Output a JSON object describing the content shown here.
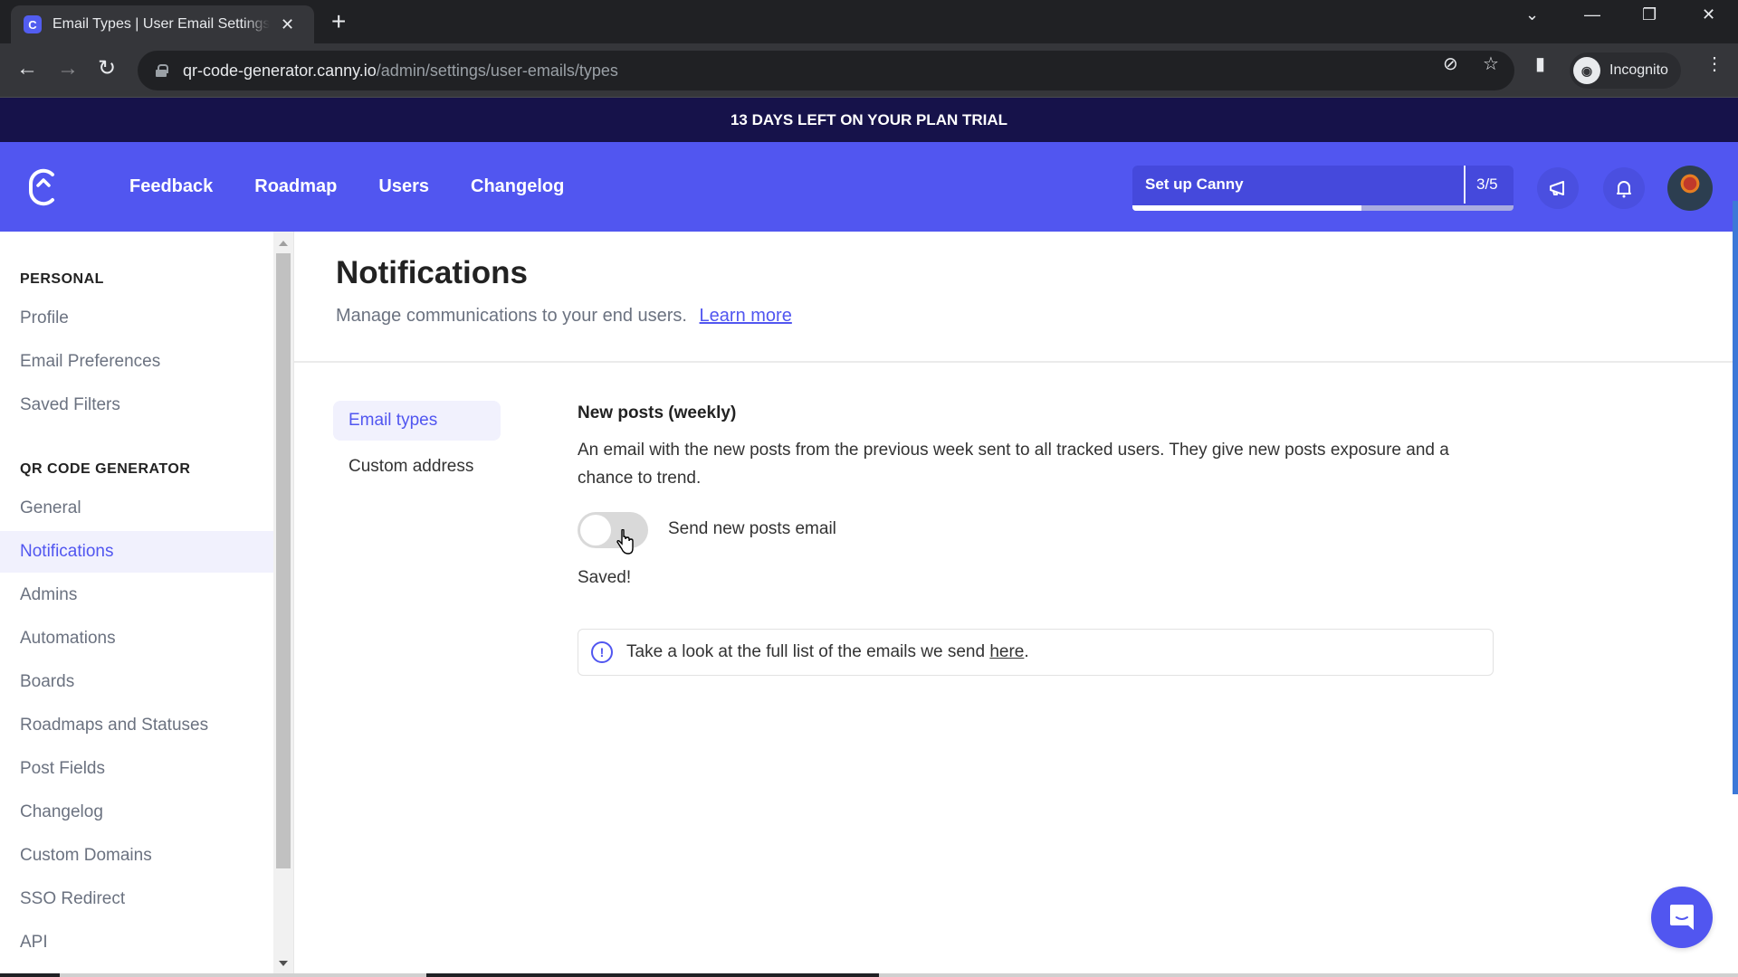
{
  "browser": {
    "tab_title": "Email Types | User Email Settings",
    "tab_favicon": "canny-icon",
    "url_host": "qr-code-generator.canny.io",
    "url_path": "/admin/settings/user-emails/types",
    "profile_label": "Incognito"
  },
  "banner": {
    "text": "13 DAYS LEFT ON YOUR PLAN TRIAL"
  },
  "header": {
    "nav": [
      "Feedback",
      "Roadmap",
      "Users",
      "Changelog"
    ],
    "setup": {
      "label": "Set up Canny",
      "count": "3/5",
      "progress": 0.6
    }
  },
  "sidebar": {
    "sections": [
      {
        "title": "PERSONAL",
        "items": [
          "Profile",
          "Email Preferences",
          "Saved Filters"
        ]
      },
      {
        "title": "QR CODE GENERATOR",
        "items": [
          "General",
          "Notifications",
          "Admins",
          "Automations",
          "Boards",
          "Roadmaps and Statuses",
          "Post Fields",
          "Changelog",
          "Custom Domains",
          "SSO Redirect",
          "API"
        ]
      }
    ],
    "active": "Notifications"
  },
  "main": {
    "title": "Notifications",
    "subtitle": "Manage communications to your end users.",
    "learn_more": "Learn more",
    "subnav": [
      {
        "label": "Email types",
        "active": true
      },
      {
        "label": "Custom address",
        "active": false
      }
    ],
    "section": {
      "title": "New posts (weekly)",
      "description": "An email with the new posts from the previous week sent to all tracked users. They give new posts exposure and a chance to trend.",
      "toggle_label": "Send new posts email",
      "toggle_on": false,
      "status": "Saved!"
    },
    "info": {
      "text": "Take a look at the full list of the emails we send ",
      "link": "here",
      "suffix": "."
    }
  },
  "colors": {
    "brand": "#5156f0",
    "banner": "#16124a",
    "active_bg": "#f1f1fd"
  }
}
